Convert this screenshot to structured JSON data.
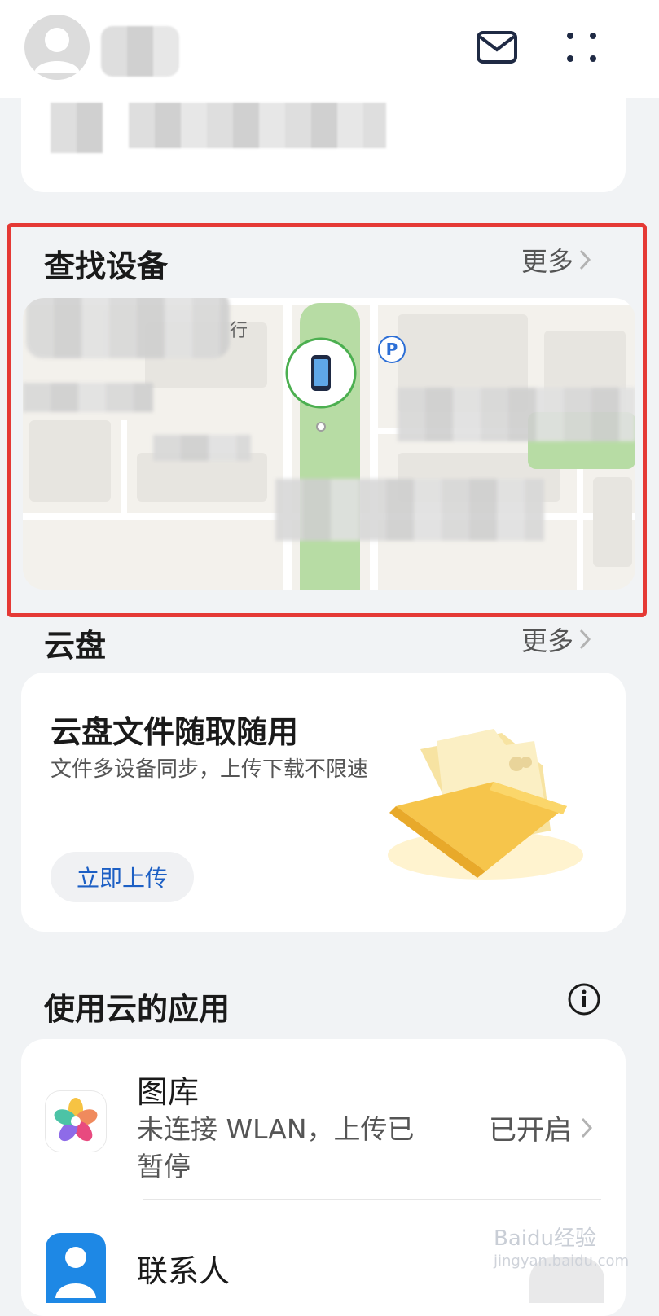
{
  "header": {
    "mail_icon": "mail-icon",
    "menu_icon": "more-dots-icon"
  },
  "find_device": {
    "title": "查找设备",
    "more_label": "更多",
    "map_labels": {
      "parking": "P",
      "road_char": "行"
    }
  },
  "cloud_drive": {
    "title": "云盘",
    "more_label": "更多",
    "card": {
      "title": "云盘文件随取随用",
      "subtitle": "文件多设备同步，上传下载不限速",
      "button": "立即上传"
    }
  },
  "cloud_apps": {
    "title": "使用云的应用",
    "info_icon": "info-icon",
    "items": [
      {
        "name": "图库",
        "subtitle_line1": "未连接 WLAN，上传已",
        "subtitle_line2": "暂停",
        "status": "已开启"
      },
      {
        "name": "联系人"
      }
    ]
  },
  "watermark": {
    "text": "Baidu经验",
    "url_text": "jingyan.baidu.com"
  },
  "colors": {
    "accent_blue": "#1c5fc4",
    "highlight_red": "#e53935",
    "map_green": "#b7dca4",
    "device_ring": "#4caf50"
  }
}
